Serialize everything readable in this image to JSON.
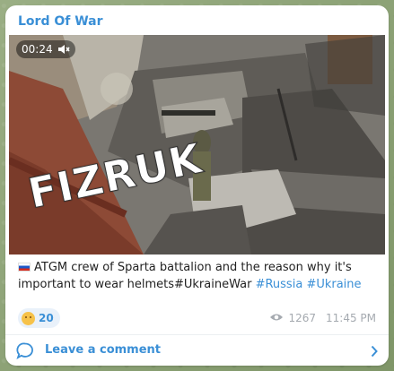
{
  "post": {
    "channel_name": "Lord Of War",
    "video_duration": "00:24",
    "watermark": "FIZRUK",
    "text_main": "ATGM crew of Sparta battalion and the reason why it's important to wear helmets#UkraineWar",
    "hashtag_1": "#Russia",
    "hashtag_2": "#Ukraine",
    "reaction_count": "20",
    "views": "1267",
    "time": "11:45 PM"
  },
  "footer": {
    "comment_label": "Leave a comment"
  },
  "icons": {
    "mute": "muted-speaker-icon",
    "flag": "russia-flag-icon",
    "reaction": "grinning-emoji-icon",
    "views": "eye-icon",
    "comment": "comment-bubble-icon",
    "chevron": "chevron-right-icon"
  },
  "colors": {
    "accent": "#3a8fd6",
    "background": "#8fa37a",
    "meta_gray": "#a5aab0"
  }
}
